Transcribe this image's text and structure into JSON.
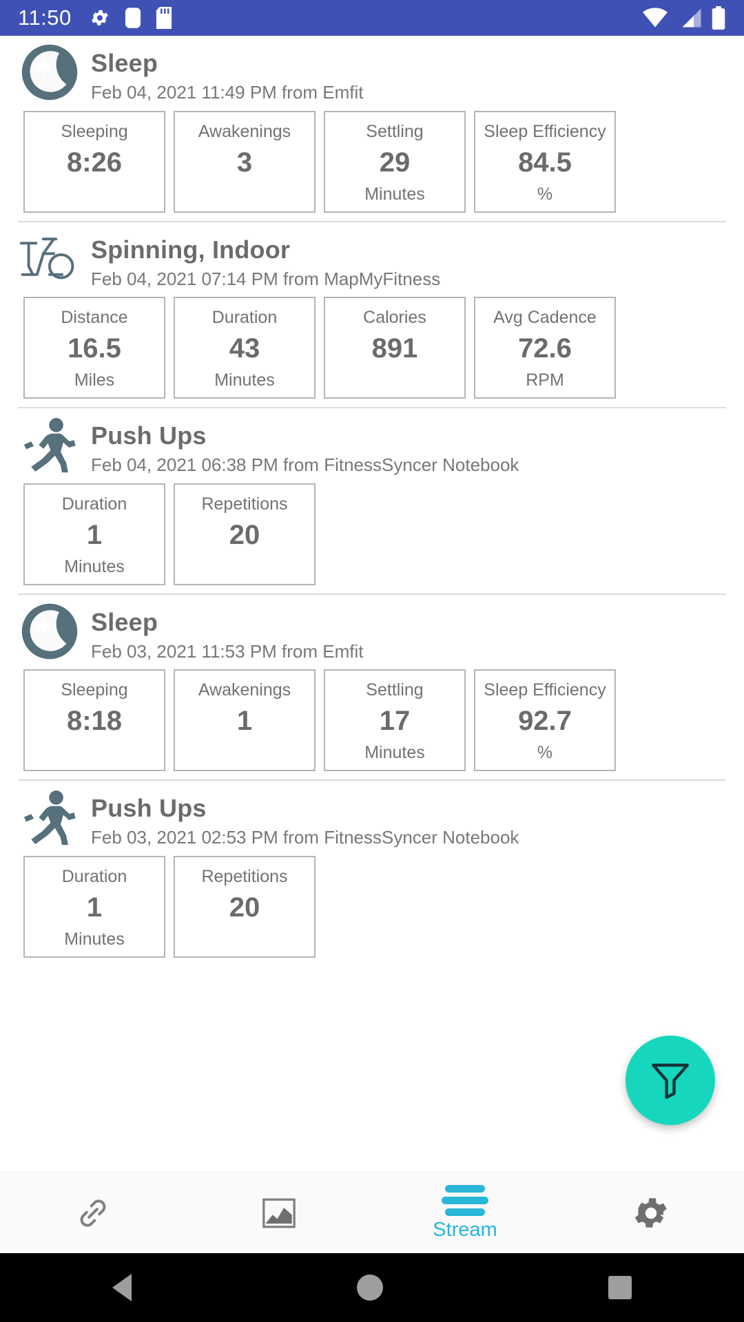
{
  "statusbar": {
    "time": "11:50",
    "left_icons": [
      "gear-icon",
      "rounded-square-icon",
      "sd-card-icon"
    ],
    "right_icons": [
      "wifi-icon",
      "cell-signal-icon",
      "battery-icon"
    ],
    "background_color": "#3f51b5"
  },
  "entries": [
    {
      "icon": "sleep-moon-star-icon",
      "title": "Sleep",
      "subtitle": "Feb 04, 2021 11:49 PM from Emfit",
      "metrics": [
        {
          "label": "Sleeping",
          "value": "8:26",
          "unit": ""
        },
        {
          "label": "Awakenings",
          "value": "3",
          "unit": ""
        },
        {
          "label": "Settling",
          "value": "29",
          "unit": "Minutes"
        },
        {
          "label": "Sleep Efficiency",
          "value": "84.5",
          "unit": "%"
        }
      ]
    },
    {
      "icon": "stationary-bike-icon",
      "title": "Spinning, Indoor",
      "subtitle": "Feb 04, 2021 07:14 PM from MapMyFitness",
      "metrics": [
        {
          "label": "Distance",
          "value": "16.5",
          "unit": "Miles"
        },
        {
          "label": "Duration",
          "value": "43",
          "unit": "Minutes"
        },
        {
          "label": "Calories",
          "value": "891",
          "unit": ""
        },
        {
          "label": "Avg Cadence",
          "value": "72.6",
          "unit": "RPM"
        }
      ]
    },
    {
      "icon": "running-person-icon",
      "title": "Push Ups",
      "subtitle": "Feb 04, 2021 06:38 PM from FitnessSyncer Notebook",
      "metrics": [
        {
          "label": "Duration",
          "value": "1",
          "unit": "Minutes"
        },
        {
          "label": "Repetitions",
          "value": "20",
          "unit": ""
        }
      ]
    },
    {
      "icon": "sleep-moon-star-icon",
      "title": "Sleep",
      "subtitle": "Feb 03, 2021 11:53 PM from Emfit",
      "metrics": [
        {
          "label": "Sleeping",
          "value": "8:18",
          "unit": ""
        },
        {
          "label": "Awakenings",
          "value": "1",
          "unit": ""
        },
        {
          "label": "Settling",
          "value": "17",
          "unit": "Minutes"
        },
        {
          "label": "Sleep Efficiency",
          "value": "92.7",
          "unit": "%"
        }
      ]
    },
    {
      "icon": "running-person-icon",
      "title": "Push Ups",
      "subtitle": "Feb 03, 2021 02:53 PM from FitnessSyncer Notebook",
      "metrics": [
        {
          "label": "Duration",
          "value": "1",
          "unit": "Minutes"
        },
        {
          "label": "Repetitions",
          "value": "20",
          "unit": ""
        }
      ]
    }
  ],
  "fab": {
    "icon": "filter-funnel-icon",
    "color": "#16d7bd"
  },
  "bottomnav": {
    "accent_color": "#29b6d8",
    "items": [
      {
        "icon": "link-chain-icon",
        "label": ""
      },
      {
        "icon": "chart-icon",
        "label": ""
      },
      {
        "icon": "stream-bars-icon",
        "label": "Stream"
      },
      {
        "icon": "gear-icon",
        "label": ""
      }
    ]
  },
  "sysnav": {
    "icons": [
      "back-triangle-icon",
      "home-circle-icon",
      "recents-square-icon"
    ]
  }
}
